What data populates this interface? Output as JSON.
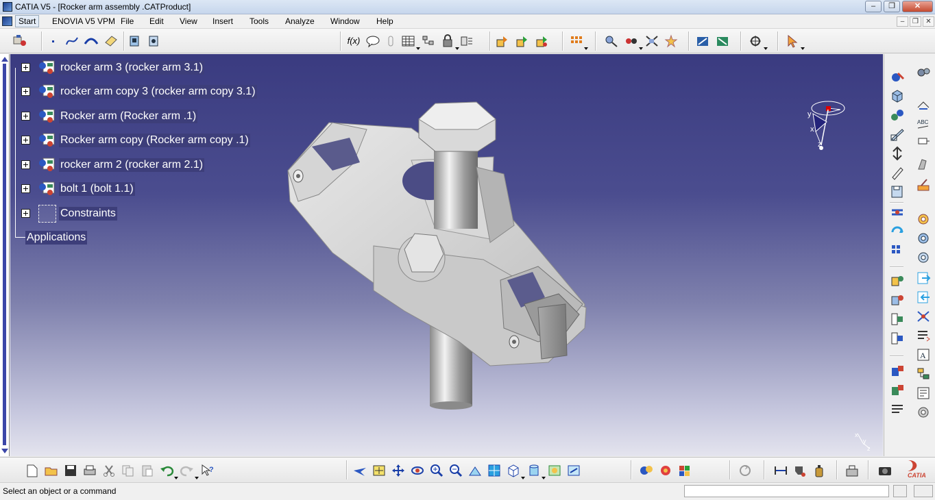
{
  "window": {
    "title": "CATIA V5 - [Rocker arm assembly .CATProduct]",
    "controls": {
      "minimize": "–",
      "restore": "❐",
      "close": "✕"
    }
  },
  "menu": {
    "items": [
      {
        "id": "start",
        "label": "Start"
      },
      {
        "id": "enovia",
        "label": "ENOVIA V5 VPM"
      },
      {
        "id": "file",
        "label": "File"
      },
      {
        "id": "edit",
        "label": "Edit"
      },
      {
        "id": "view",
        "label": "View"
      },
      {
        "id": "insert",
        "label": "Insert"
      },
      {
        "id": "tools",
        "label": "Tools"
      },
      {
        "id": "analyze",
        "label": "Analyze"
      },
      {
        "id": "window",
        "label": "Window"
      },
      {
        "id": "help",
        "label": "Help"
      }
    ],
    "mdi_controls": {
      "minimize": "–",
      "restore": "❐",
      "close": "✕"
    }
  },
  "tree": {
    "nodes": [
      {
        "label": "rocker arm 3 (rocker arm 3.1)",
        "icon": "part-instance-icon"
      },
      {
        "label": "rocker arm copy 3 (rocker arm copy 3.1)",
        "icon": "part-instance-icon"
      },
      {
        "label": "Rocker arm  (Rocker arm .1)",
        "icon": "part-instance-icon"
      },
      {
        "label": "Rocker arm  copy  (Rocker arm  copy .1)",
        "icon": "part-instance-icon"
      },
      {
        "label": "rocker arm 2 (rocker arm 2.1)",
        "icon": "part-instance-icon"
      },
      {
        "label": "bolt 1 (bolt 1.1)",
        "icon": "part-instance-icon"
      },
      {
        "label": "Constraints",
        "icon": "constraints-icon"
      }
    ],
    "applications_label": "Applications"
  },
  "compass": {
    "x_label": "x",
    "y_label": "y",
    "z_label": "z"
  },
  "axis_indicator": {
    "x_label": "x",
    "y_label": "y",
    "z_label": "z"
  },
  "status": {
    "message": "Select an object or a command",
    "command_input_value": ""
  },
  "brand": {
    "logo_text": "CATIA"
  },
  "colors": {
    "viewport_top": "#3a3b80",
    "viewport_bottom": "#e4e4ee",
    "tree_text": "#ffffff",
    "titlebar": "#c6d6ec"
  }
}
